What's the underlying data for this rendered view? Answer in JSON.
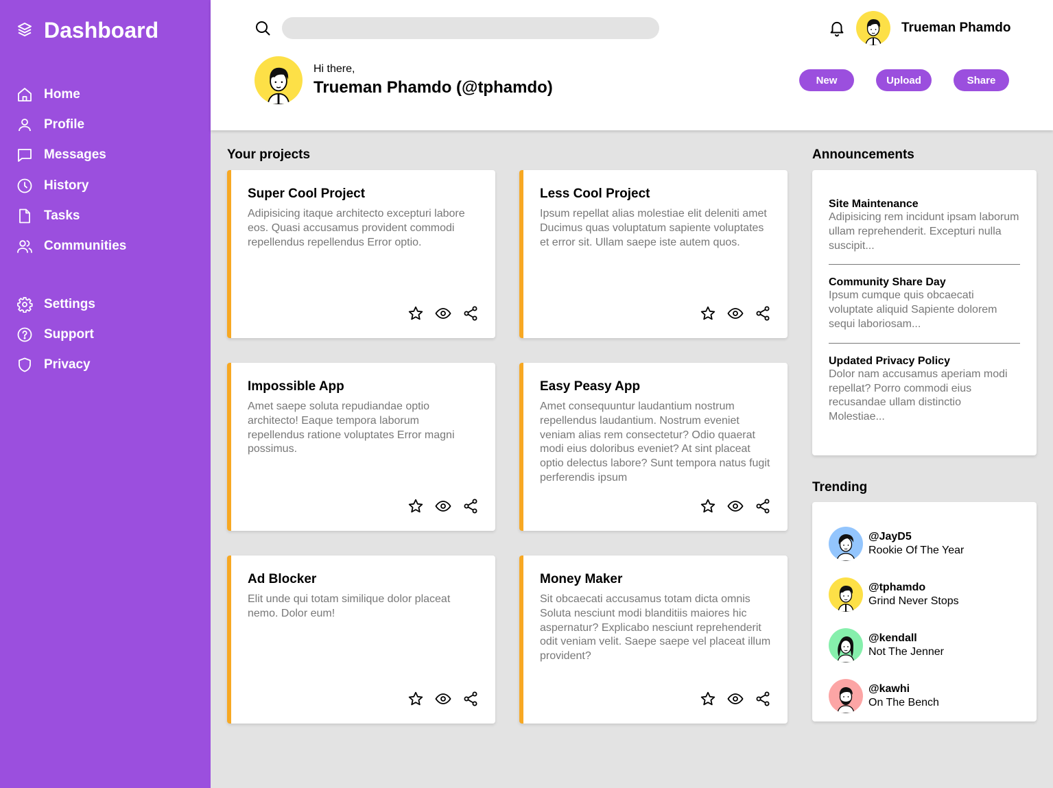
{
  "brand": {
    "title": "Dashboard",
    "icon": "layers-icon"
  },
  "nav_primary": [
    {
      "label": "Home",
      "icon": "home-icon"
    },
    {
      "label": "Profile",
      "icon": "user-icon"
    },
    {
      "label": "Messages",
      "icon": "chat-icon"
    },
    {
      "label": "History",
      "icon": "clock-icon"
    },
    {
      "label": "Tasks",
      "icon": "document-icon"
    },
    {
      "label": "Communities",
      "icon": "users-icon"
    }
  ],
  "nav_secondary": [
    {
      "label": "Settings",
      "icon": "gear-icon"
    },
    {
      "label": "Support",
      "icon": "help-icon"
    },
    {
      "label": "Privacy",
      "icon": "shield-icon"
    }
  ],
  "header": {
    "search_placeholder": "",
    "username": "Trueman Phamdo",
    "greeting": "Hi there,",
    "display_name": "Trueman Phamdo (@tphamdo)",
    "buttons": {
      "new": "New",
      "upload": "Upload",
      "share": "Share"
    }
  },
  "projects": {
    "title": "Your projects",
    "items": [
      {
        "name": "Super Cool Project",
        "description": "Adipisicing itaque architecto excepturi labore eos. Quasi accusamus provident commodi repellendus repellendus Error optio."
      },
      {
        "name": "Less Cool Project",
        "description": "Ipsum repellat alias molestiae elit deleniti amet Ducimus quas voluptatum sapiente voluptates et error sit. Ullam saepe iste autem quos."
      },
      {
        "name": "Impossible App",
        "description": "Amet saepe soluta repudiandae optio architecto! Eaque tempora laborum repellendus ratione voluptates Error magni possimus."
      },
      {
        "name": "Easy Peasy App",
        "description": "Amet consequuntur laudantium nostrum repellendus laudantium. Nostrum eveniet veniam alias rem consectetur? Odio quaerat modi eius doloribus eveniet? At sint placeat optio delectus labore? Sunt tempora natus fugit perferendis ipsum"
      },
      {
        "name": "Ad Blocker",
        "description": "Elit unde qui totam similique dolor placeat nemo. Dolor eum!"
      },
      {
        "name": "Money Maker",
        "description": "Sit obcaecati accusamus totam dicta omnis Soluta nesciunt modi blanditiis maiores hic aspernatur? Explicabo nesciunt reprehenderit odit veniam velit. Saepe saepe vel placeat illum provident?"
      }
    ]
  },
  "announcements": {
    "title": "Announcements",
    "items": [
      {
        "title": "Site Maintenance",
        "body": "Adipisicing rem incidunt ipsam laborum ullam reprehenderit. Excepturi nulla suscipit..."
      },
      {
        "title": "Community Share Day",
        "body": "Ipsum cumque quis obcaecati voluptate aliquid Sapiente dolorem sequi laboriosam..."
      },
      {
        "title": "Updated Privacy Policy",
        "body": "Dolor nam accusamus aperiam modi repellat? Porro commodi eius recusandae ullam distinctio Molestiae..."
      }
    ]
  },
  "trending": {
    "title": "Trending",
    "items": [
      {
        "handle": "@JayD5",
        "tagline": "Rookie Of The Year",
        "color": "#93c5fd"
      },
      {
        "handle": "@tphamdo",
        "tagline": "Grind Never Stops",
        "color": "#fde047"
      },
      {
        "handle": "@kendall",
        "tagline": "Not The Jenner",
        "color": "#86efac"
      },
      {
        "handle": "@kawhi",
        "tagline": "On The Bench",
        "color": "#fca5a5"
      }
    ]
  },
  "colors": {
    "sidebar": "#9b4fde",
    "accent": "#f7a823",
    "background": "#e3e3e3"
  }
}
